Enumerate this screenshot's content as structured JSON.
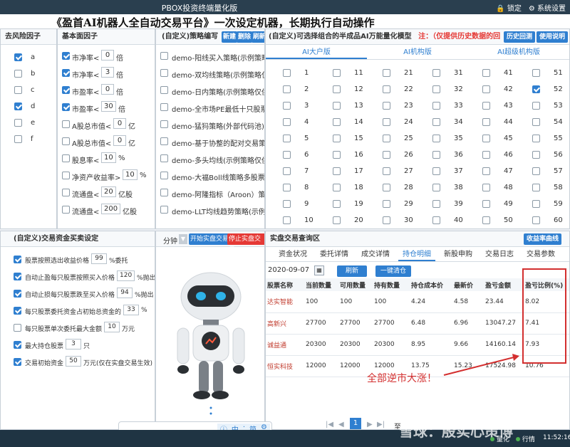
{
  "window": {
    "title": "PBOX投资终端量化版",
    "lock": "锁定",
    "settings": "系统设置"
  },
  "banner": {
    "headline": "《盈首AI机器人全自动交易平台》一次设定机器，长期执行自动操作"
  },
  "risk_factor": {
    "title": "去风险因子",
    "items": [
      {
        "label": "a",
        "checked": true
      },
      {
        "label": "b",
        "checked": false
      },
      {
        "label": "c",
        "checked": false
      },
      {
        "label": "d",
        "checked": true
      },
      {
        "label": "e",
        "checked": false
      },
      {
        "label": "f",
        "checked": false
      }
    ]
  },
  "fundamental": {
    "title": "基本面因子",
    "items": [
      {
        "label": "市净率<",
        "value": "0",
        "unit": "倍",
        "checked": true
      },
      {
        "label": "市净率<",
        "value": "3",
        "unit": "倍",
        "checked": true
      },
      {
        "label": "市盈率<",
        "value": "0",
        "unit": "倍",
        "checked": true
      },
      {
        "label": "市盈率<",
        "value": "30",
        "unit": "倍",
        "checked": true
      },
      {
        "label": "A股总市值<",
        "value": "0",
        "unit": "亿",
        "checked": false
      },
      {
        "label": "A股总市值<",
        "value": "0",
        "unit": "亿",
        "checked": false
      },
      {
        "label": "股息率<",
        "value": "10",
        "unit": "%",
        "checked": false
      },
      {
        "label": "净资产收益率>",
        "value": "10",
        "unit": "%",
        "checked": false
      },
      {
        "label": "流通盘<",
        "value": "20",
        "unit": "亿股",
        "checked": false
      },
      {
        "label": "流通盘<",
        "value": "200",
        "unit": "亿股",
        "checked": false
      }
    ]
  },
  "strategy": {
    "title": "(自定义)策略编写",
    "new_label": "新建",
    "delete_label": "删除",
    "refresh_label": "刷新",
    "items": [
      "demo-阳线买入策略(示例策略",
      "demo-双均线策略(示例策略仅供参",
      "demo-日内策略(示例策略仅供参考",
      "demo-全市场PE最低十只股票(示例",
      "demo-猛犸策略(外部代码池)(示例",
      "demo-基于协整的配对交易策略(示",
      "demo-多头均线(示例策略仅供参考",
      "demo-大福Boll线策略多股票版本",
      "demo-阿隆指标（Aroon）策略(示",
      "demo-LLT均线趋势策略(示例策略"
    ]
  },
  "ai_model": {
    "title": "(自定义)可选择组合的半成品AI万能量化模型",
    "note": "注：（仅提供历史数据的回",
    "history_label": "历史回测",
    "manual_label": "使用说明",
    "tabs": [
      "AI大户版",
      "AI机构版",
      "AI超级机构版"
    ],
    "checked_numbers": [
      52
    ]
  },
  "capital": {
    "title": "(自定义)交易资金买卖设定",
    "rows": [
      {
        "checked": true,
        "pre": "股票按照选出收益价格",
        "value": "99",
        "post": "%委托"
      },
      {
        "checked": true,
        "pre": "自动止盈每只股票按照买入价格",
        "value": "120",
        "post": "%抛出"
      },
      {
        "checked": true,
        "pre": "自动止损每只股票跌至买入价格",
        "value": "94",
        "post": "%抛出"
      },
      {
        "checked": true,
        "pre": "每只股票委托资金占初始总资金的",
        "value": "33",
        "post": "%"
      },
      {
        "checked": false,
        "pre": "每只股票单次委托最大金额",
        "value": "10",
        "post": "万元"
      },
      {
        "checked": true,
        "pre": "最大持仓股票",
        "value": "3",
        "post": "只"
      },
      {
        "checked": true,
        "pre": "交易初始资金",
        "value": "50",
        "post": "万元(仅在实盘交易生效)"
      }
    ]
  },
  "robot_panel": {
    "period_label": "分钟",
    "start_label": "开始实盘交易",
    "stop_label": "停止实盘交易"
  },
  "trade_panel": {
    "title": "实盘交易查询区",
    "curve_label": "收益率曲线",
    "tabs": [
      "资金状况",
      "委托详情",
      "成交详情",
      "持仓明细",
      "新股申购",
      "交易日志",
      "交易参数"
    ],
    "active_tab": "持仓明细",
    "date": "2020-09-07",
    "refresh_label": "刷新",
    "clear_label": "一键清仓",
    "headers": [
      "股票名称",
      "当前数量",
      "可用数量",
      "持有数量",
      "持仓成本价",
      "最新价",
      "盈亏金额",
      "盈亏比例(%)"
    ],
    "rows": [
      [
        "达实智能",
        "100",
        "100",
        "100",
        "4.24",
        "4.58",
        "23.44",
        "8.02"
      ],
      [
        "高新兴",
        "27700",
        "27700",
        "27700",
        "6.48",
        "6.96",
        "13047.27",
        "7.41"
      ],
      [
        "诚益通",
        "20300",
        "20300",
        "20300",
        "8.95",
        "9.66",
        "14160.14",
        "7.93"
      ],
      [
        "恒实科技",
        "12000",
        "12000",
        "12000",
        "13.75",
        "15.23",
        "17524.98",
        "10.76"
      ]
    ],
    "annotation": "全部逆市大涨！",
    "page": "1",
    "page_to": "至"
  },
  "ime": {
    "items": [
      "中",
      "·",
      "简"
    ]
  },
  "statusbar": {
    "quant": "量化",
    "market": "行情",
    "time": "11:52:16"
  },
  "watermark": "雪球：殷实心策博",
  "colors": {
    "accent": "#2f7fd0",
    "stop": "#e53935",
    "highlight": "#d32f2f"
  }
}
